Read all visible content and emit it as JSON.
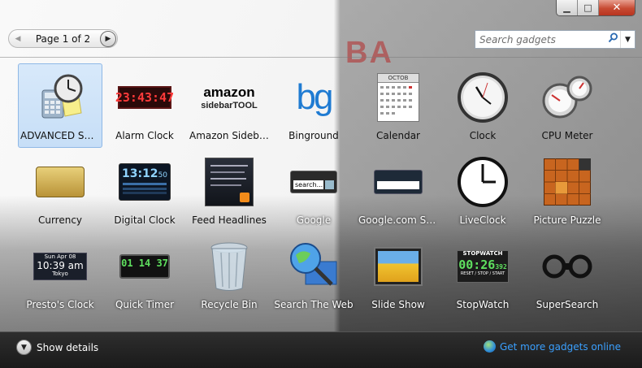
{
  "window": {
    "minimize_glyph": "▁",
    "maximize_glyph": "□",
    "close_glyph": "✕"
  },
  "pager": {
    "label": "Page 1 of 2",
    "prev_glyph": "◀",
    "next_glyph": "▶"
  },
  "search": {
    "placeholder": "Search gadgets",
    "icon": "search-icon",
    "dropdown_glyph": "▼"
  },
  "background": {
    "brand_text": "BA"
  },
  "gadgets": [
    {
      "label": "ADVANCED SEA...",
      "selected": true
    },
    {
      "label": "Alarm Clock",
      "alarm_time": "23:43:47"
    },
    {
      "label": "Amazon Sideba...",
      "logo_line1": "amazon",
      "logo_line2": "sidebarTOOL"
    },
    {
      "label": "Binground",
      "logo": "bg"
    },
    {
      "label": "Calendar",
      "month": "OCTOB"
    },
    {
      "label": "Clock"
    },
    {
      "label": "CPU Meter"
    },
    {
      "label": "Currency"
    },
    {
      "label": "Digital Clock",
      "time": "13:12",
      "seconds": "50"
    },
    {
      "label": "Feed Headlines"
    },
    {
      "label": "Google",
      "search_btn": "search..."
    },
    {
      "label": "Google.com Se..."
    },
    {
      "label": "LiveClock"
    },
    {
      "label": "Picture Puzzle"
    },
    {
      "label": "Presto's Clock",
      "date": "Sun Apr 08",
      "time": "10:39 am",
      "city": "Tokyo"
    },
    {
      "label": "Quick Timer",
      "time": "01 14 37"
    },
    {
      "label": "Recycle Bin"
    },
    {
      "label": "Search The Web"
    },
    {
      "label": "Slide Show"
    },
    {
      "label": "StopWatch",
      "header": "STOPWATCH",
      "time": "00:26",
      "ms": "392",
      "footer": "RESET / STOP / START"
    },
    {
      "label": "SuperSearch"
    }
  ],
  "bottombar": {
    "details_label": "Show details",
    "more_label": "Get more gadgets online"
  },
  "colors": {
    "link": "#3aa0ff",
    "selection": "#c4ddf7"
  }
}
